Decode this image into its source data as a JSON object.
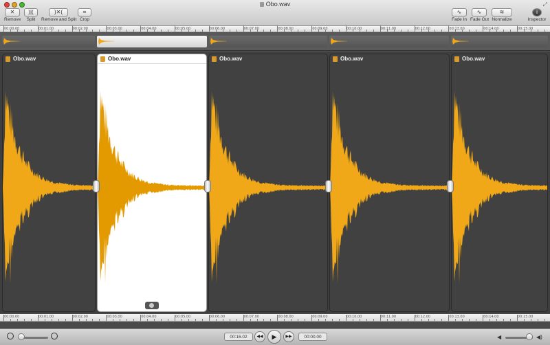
{
  "window": {
    "title": "Obo.wav"
  },
  "toolbar": {
    "remove": {
      "icon": "remove-icon",
      "glyph": "✕",
      "label": "Remove"
    },
    "split": {
      "icon": "split-icon",
      "glyph": ")|(",
      "label": "Split"
    },
    "remove_split": {
      "icon": "remove-split-icon",
      "glyph": ")✕(",
      "label": "Remove and Split"
    },
    "crop": {
      "icon": "crop-icon",
      "glyph": "⌗",
      "label": "Crop"
    },
    "fade_in": {
      "icon": "fade-in-icon",
      "glyph": "∿",
      "label": "Fade In"
    },
    "fade_out": {
      "icon": "fade-out-icon",
      "glyph": "∿",
      "label": "Fade Out"
    },
    "normalize": {
      "icon": "normalize-icon",
      "glyph": "≋",
      "label": "Normalize"
    },
    "inspector": {
      "icon": "inspector-icon",
      "glyph": "i",
      "label": "Inspector"
    }
  },
  "ruler_labels": [
    "00:00.00",
    "00:01.00",
    "00:02.00",
    "00:03.00",
    "00:04.00",
    "00:05.00",
    "00:06.00",
    "00:07.00",
    "00:08.00",
    "00:09.00",
    "00:10.00",
    "00:11.00",
    "00:12.00",
    "00:13.00",
    "00:14.00",
    "00:15.00"
  ],
  "clips": [
    {
      "name": "Obo.wav",
      "selected": false
    },
    {
      "name": "Obo.wav",
      "selected": true
    },
    {
      "name": "Obo.wav",
      "selected": false
    },
    {
      "name": "Obo.wav",
      "selected": false
    },
    {
      "name": "Obo.wav",
      "selected": false
    }
  ],
  "transport": {
    "duration": "00:16.02",
    "position": "00:00.00",
    "rewind_glyph": "◀◀",
    "play_glyph": "▶",
    "forward_glyph": "▶▶"
  },
  "colors": {
    "waveform": "#f0a818",
    "waveform_selected": "#e39a00",
    "clip_bg": "#414141",
    "clip_selected_bg": "#ffffff"
  }
}
